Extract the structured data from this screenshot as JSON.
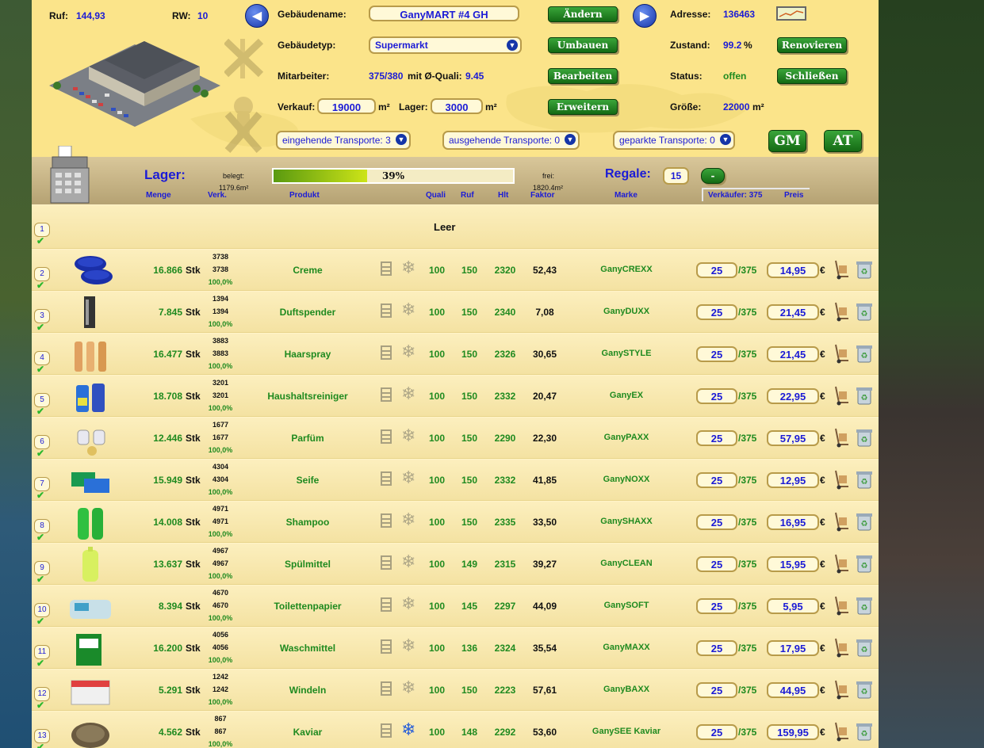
{
  "header": {
    "ruf_label": "Ruf:",
    "ruf_value": "144,93",
    "rw_label": "RW:",
    "rw_value": "10",
    "gebaeudename_label": "Gebäudename:",
    "gebaeudename_value": "GanyMART #4 GH",
    "aendern_label": "Ändern",
    "adresse_label": "Adresse:",
    "adresse_value": "136463",
    "gebaeudetyp_label": "Gebäudetyp:",
    "gebaeudetyp_value": "Supermarkt",
    "umbauen_label": "Umbauen",
    "zustand_label": "Zustand:",
    "zustand_value": "99.2",
    "zustand_unit": "%",
    "renovieren_label": "Renovieren",
    "mitarbeiter_label": "Mitarbeiter:",
    "mitarbeiter_value": "375/380",
    "mit_quali_label": "mit Ø-Quali:",
    "mit_quali_value": "9.45",
    "bearbeiten_label": "Bearbeiten",
    "status_label": "Status:",
    "status_value": "offen",
    "schliessen_label": "Schließen",
    "verkauf_label": "Verkauf:",
    "verkauf_value": "19000",
    "verkauf_unit": "m²",
    "lager_label": "Lager:",
    "lager_value": "3000",
    "lager_unit": "m²",
    "erweitern_label": "Erweitern",
    "groesse_label": "Größe:",
    "groesse_value": "22000",
    "groesse_unit": "m²",
    "eingehende": "eingehende Transporte: 3",
    "ausgehende": "ausgehende Transporte: 0",
    "geparkte": "geparkte Transporte: 0",
    "gm_label": "GM",
    "at_label": "AT"
  },
  "subheader": {
    "lager_title": "Lager:",
    "belegt_label": "belegt:",
    "belegt_value": "1179.6m²",
    "progress_percent": 39,
    "progress_text": "39%",
    "frei_label": "frei:",
    "frei_value": "1820.4m²",
    "regale_label": "Regale:",
    "regale_value": "15",
    "minus_label": "-",
    "columns": {
      "menge": "Menge",
      "verk": "Verk.",
      "produkt": "Produkt",
      "quali": "Quali",
      "ruf": "Ruf",
      "hlt": "Hlt",
      "faktor": "Faktor",
      "marke": "Marke",
      "verkaeufer": "Verkäufer: 375",
      "preis": "Preis"
    }
  },
  "empty_row": {
    "num": "1",
    "text": "Leer"
  },
  "rows": [
    {
      "num": "2",
      "menge": "16.866",
      "stk": "Stk",
      "verk1": "3738",
      "verk2": "3738",
      "verk3": "100,0%",
      "produkt": "Creme",
      "quali": "100",
      "ruf": "150",
      "hlt": "2320",
      "faktor": "52,43",
      "marke": "GanyCREXX",
      "vk": "25",
      "vkmax": "/375",
      "preis": "14,95",
      "euro": "€",
      "icon": "creme",
      "snow": false
    },
    {
      "num": "3",
      "menge": "7.845",
      "stk": "Stk",
      "verk1": "1394",
      "verk2": "1394",
      "verk3": "100,0%",
      "produkt": "Duftspender",
      "quali": "100",
      "ruf": "150",
      "hlt": "2340",
      "faktor": "7,08",
      "marke": "GanyDUXX",
      "vk": "25",
      "vkmax": "/375",
      "preis": "21,45",
      "euro": "€",
      "icon": "duft",
      "snow": false
    },
    {
      "num": "4",
      "menge": "16.477",
      "stk": "Stk",
      "verk1": "3883",
      "verk2": "3883",
      "verk3": "100,0%",
      "produkt": "Haarspray",
      "quali": "100",
      "ruf": "150",
      "hlt": "2326",
      "faktor": "30,65",
      "marke": "GanySTYLE",
      "vk": "25",
      "vkmax": "/375",
      "preis": "21,45",
      "euro": "€",
      "icon": "spray",
      "snow": false
    },
    {
      "num": "5",
      "menge": "18.708",
      "stk": "Stk",
      "verk1": "3201",
      "verk2": "3201",
      "verk3": "100,0%",
      "produkt": "Haushaltsreiniger",
      "quali": "100",
      "ruf": "150",
      "hlt": "2332",
      "faktor": "20,47",
      "marke": "GanyEX",
      "vk": "25",
      "vkmax": "/375",
      "preis": "22,95",
      "euro": "€",
      "icon": "reiniger",
      "snow": false
    },
    {
      "num": "6",
      "menge": "12.446",
      "stk": "Stk",
      "verk1": "1677",
      "verk2": "1677",
      "verk3": "100,0%",
      "produkt": "Parfüm",
      "quali": "100",
      "ruf": "150",
      "hlt": "2290",
      "faktor": "22,30",
      "marke": "GanyPAXX",
      "vk": "25",
      "vkmax": "/375",
      "preis": "57,95",
      "euro": "€",
      "icon": "parfum",
      "snow": false
    },
    {
      "num": "7",
      "menge": "15.949",
      "stk": "Stk",
      "verk1": "4304",
      "verk2": "4304",
      "verk3": "100,0%",
      "produkt": "Seife",
      "quali": "100",
      "ruf": "150",
      "hlt": "2332",
      "faktor": "41,85",
      "marke": "GanyNOXX",
      "vk": "25",
      "vkmax": "/375",
      "preis": "12,95",
      "euro": "€",
      "icon": "seife",
      "snow": false
    },
    {
      "num": "8",
      "menge": "14.008",
      "stk": "Stk",
      "verk1": "4971",
      "verk2": "4971",
      "verk3": "100,0%",
      "produkt": "Shampoo",
      "quali": "100",
      "ruf": "150",
      "hlt": "2335",
      "faktor": "33,50",
      "marke": "GanySHAXX",
      "vk": "25",
      "vkmax": "/375",
      "preis": "16,95",
      "euro": "€",
      "icon": "shampoo",
      "snow": false
    },
    {
      "num": "9",
      "menge": "13.637",
      "stk": "Stk",
      "verk1": "4967",
      "verk2": "4967",
      "verk3": "100,0%",
      "produkt": "Spülmittel",
      "quali": "100",
      "ruf": "149",
      "hlt": "2315",
      "faktor": "39,27",
      "marke": "GanyCLEAN",
      "vk": "25",
      "vkmax": "/375",
      "preis": "15,95",
      "euro": "€",
      "icon": "spuel",
      "snow": false
    },
    {
      "num": "10",
      "menge": "8.394",
      "stk": "Stk",
      "verk1": "4670",
      "verk2": "4670",
      "verk3": "100,0%",
      "produkt": "Toilettenpapier",
      "quali": "100",
      "ruf": "145",
      "hlt": "2297",
      "faktor": "44,09",
      "marke": "GanySOFT",
      "vk": "25",
      "vkmax": "/375",
      "preis": "5,95",
      "euro": "€",
      "icon": "papier",
      "snow": false
    },
    {
      "num": "11",
      "menge": "16.200",
      "stk": "Stk",
      "verk1": "4056",
      "verk2": "4056",
      "verk3": "100,0%",
      "produkt": "Waschmittel",
      "quali": "100",
      "ruf": "136",
      "hlt": "2324",
      "faktor": "35,54",
      "marke": "GanyMAXX",
      "vk": "25",
      "vkmax": "/375",
      "preis": "17,95",
      "euro": "€",
      "icon": "wasch",
      "snow": false
    },
    {
      "num": "12",
      "menge": "5.291",
      "stk": "Stk",
      "verk1": "1242",
      "verk2": "1242",
      "verk3": "100,0%",
      "produkt": "Windeln",
      "quali": "100",
      "ruf": "150",
      "hlt": "2223",
      "faktor": "57,61",
      "marke": "GanyBAXX",
      "vk": "25",
      "vkmax": "/375",
      "preis": "44,95",
      "euro": "€",
      "icon": "windeln",
      "snow": false
    },
    {
      "num": "13",
      "menge": "4.562",
      "stk": "Stk",
      "verk1": "867",
      "verk2": "867",
      "verk3": "100,0%",
      "produkt": "Kaviar",
      "quali": "100",
      "ruf": "148",
      "hlt": "2292",
      "faktor": "53,60",
      "marke": "GanySEE Kaviar",
      "vk": "25",
      "vkmax": "/375",
      "preis": "159,95",
      "euro": "€",
      "icon": "kaviar",
      "snow": true
    }
  ]
}
